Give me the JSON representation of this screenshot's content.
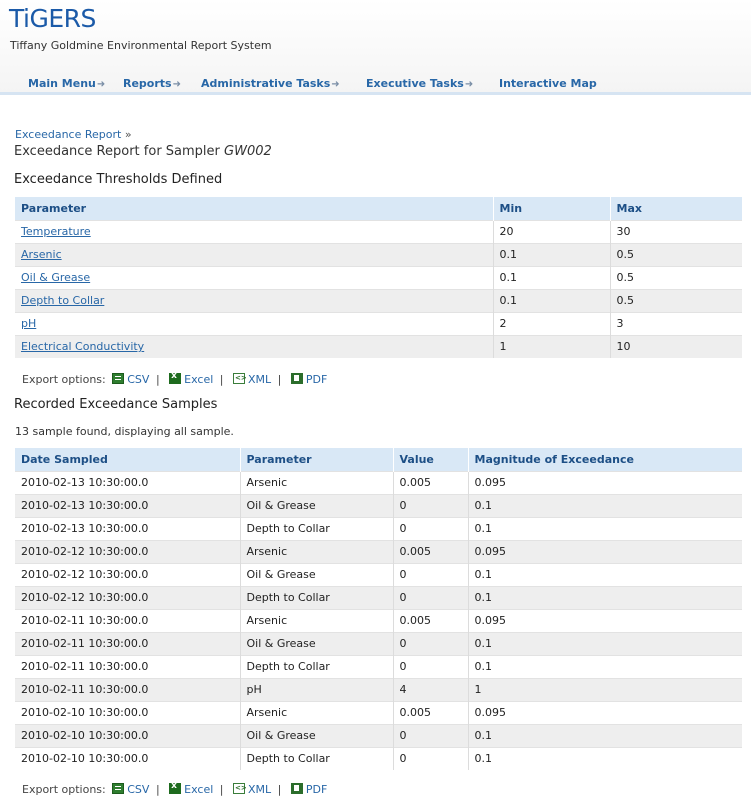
{
  "header": {
    "logo": "TiGERS",
    "subtitle": "Tiffany Goldmine Environmental Report System"
  },
  "nav": [
    {
      "label": "Main Menu",
      "arrow": "➜"
    },
    {
      "label": "Reports",
      "arrow": "➜"
    },
    {
      "label": "Administrative Tasks",
      "arrow": "➜"
    },
    {
      "label": "Executive Tasks",
      "arrow": "➜"
    },
    {
      "label": "Interactive Map",
      "arrow": ""
    }
  ],
  "breadcrumb": {
    "link": "Exceedance Report",
    "sep": "»"
  },
  "page_title": {
    "text": "Exceedance Report for Sampler",
    "sampler": "GW002"
  },
  "thresholds": {
    "heading": "Exceedance Thresholds Defined",
    "columns": [
      "Parameter",
      "Min",
      "Max"
    ],
    "rows": [
      [
        "Temperature",
        "20",
        "30"
      ],
      [
        "Arsenic",
        "0.1",
        "0.5"
      ],
      [
        "Oil & Grease",
        "0.1",
        "0.5"
      ],
      [
        "Depth to Collar",
        "0.1",
        "0.5"
      ],
      [
        "pH",
        "2",
        "3"
      ],
      [
        "Electrical Conductivity",
        "1",
        "10"
      ]
    ]
  },
  "export": {
    "label": "Export options:",
    "csv": "CSV",
    "excel": "Excel",
    "xml": "XML",
    "pdf": "PDF",
    "sep": "|"
  },
  "samples": {
    "heading": "Recorded Exceedance Samples",
    "count_text": "13 sample found, displaying all sample.",
    "columns": [
      "Date Sampled",
      "Parameter",
      "Value",
      "Magnitude of Exceedance"
    ],
    "rows": [
      [
        "2010-02-13 10:30:00.0",
        "Arsenic",
        "0.005",
        "0.095"
      ],
      [
        "2010-02-13 10:30:00.0",
        "Oil & Grease",
        "0",
        "0.1"
      ],
      [
        "2010-02-13 10:30:00.0",
        "Depth to Collar",
        "0",
        "0.1"
      ],
      [
        "2010-02-12 10:30:00.0",
        "Arsenic",
        "0.005",
        "0.095"
      ],
      [
        "2010-02-12 10:30:00.0",
        "Oil & Grease",
        "0",
        "0.1"
      ],
      [
        "2010-02-12 10:30:00.0",
        "Depth to Collar",
        "0",
        "0.1"
      ],
      [
        "2010-02-11 10:30:00.0",
        "Arsenic",
        "0.005",
        "0.095"
      ],
      [
        "2010-02-11 10:30:00.0",
        "Oil & Grease",
        "0",
        "0.1"
      ],
      [
        "2010-02-11 10:30:00.0",
        "Depth to Collar",
        "0",
        "0.1"
      ],
      [
        "2010-02-11 10:30:00.0",
        "pH",
        "4",
        "1"
      ],
      [
        "2010-02-10 10:30:00.0",
        "Arsenic",
        "0.005",
        "0.095"
      ],
      [
        "2010-02-10 10:30:00.0",
        "Oil & Grease",
        "0",
        "0.1"
      ],
      [
        "2010-02-10 10:30:00.0",
        "Depth to Collar",
        "0",
        "0.1"
      ]
    ]
  },
  "colors": {
    "link": "#2867a7",
    "header_bg": "#d9e8f6",
    "logo": "#1b5aa8"
  }
}
